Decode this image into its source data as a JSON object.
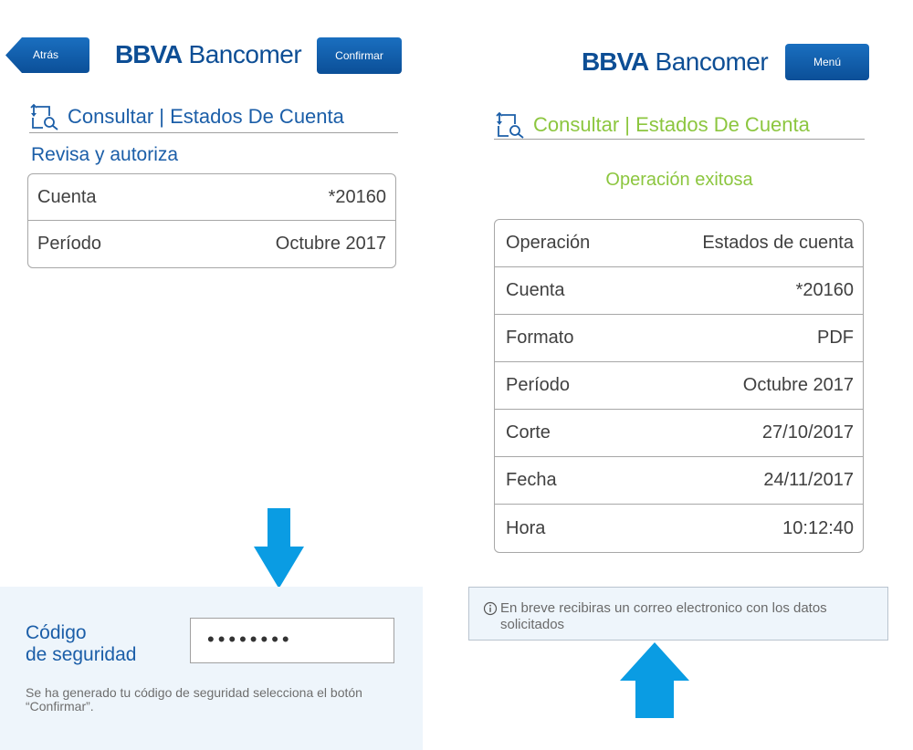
{
  "left_screen": {
    "back_label": "Atrás",
    "logo_bold": "BBVA",
    "logo_text": "Bancomer",
    "confirm_label": "Confirmar",
    "section_title": "Consultar | Estados De Cuenta",
    "subtitle": "Revisa y autoriza",
    "summary_rows": [
      {
        "label": "Cuenta",
        "value": "*20160"
      },
      {
        "label": "Período",
        "value": "Octubre 2017"
      }
    ],
    "security": {
      "label_line1": "Código",
      "label_line2": "de seguridad",
      "value": "••••••••",
      "hint": "Se ha generado tu código de seguridad selecciona el botón “Confirmar”."
    }
  },
  "right_screen": {
    "logo_bold": "BBVA",
    "logo_text": "Bancomer",
    "menu_label": "Menú",
    "section_title": "Consultar | Estados De Cuenta",
    "status": "Operación exitosa",
    "details_rows": [
      {
        "label": "Operación",
        "value": "Estados de cuenta"
      },
      {
        "label": "Cuenta",
        "value": "*20160"
      },
      {
        "label": "Formato",
        "value": "PDF"
      },
      {
        "label": "Período",
        "value": "Octubre 2017"
      },
      {
        "label": "Corte",
        "value": "27/10/2017"
      },
      {
        "label": "Fecha",
        "value": "24/11/2017"
      },
      {
        "label": "Hora",
        "value": "10:12:40"
      }
    ],
    "notice": "En breve recibiras un correo electronico con los datos solicitados"
  },
  "colors": {
    "brand_blue": "#0d4e95",
    "title_blue": "#1b5ea8",
    "success_green": "#8cc63f",
    "arrow_blue": "#0a9ce3"
  },
  "icons": [
    "search-document-icon",
    "back-arrow-icon",
    "down-arrow-icon",
    "up-arrow-icon",
    "info-icon"
  ]
}
